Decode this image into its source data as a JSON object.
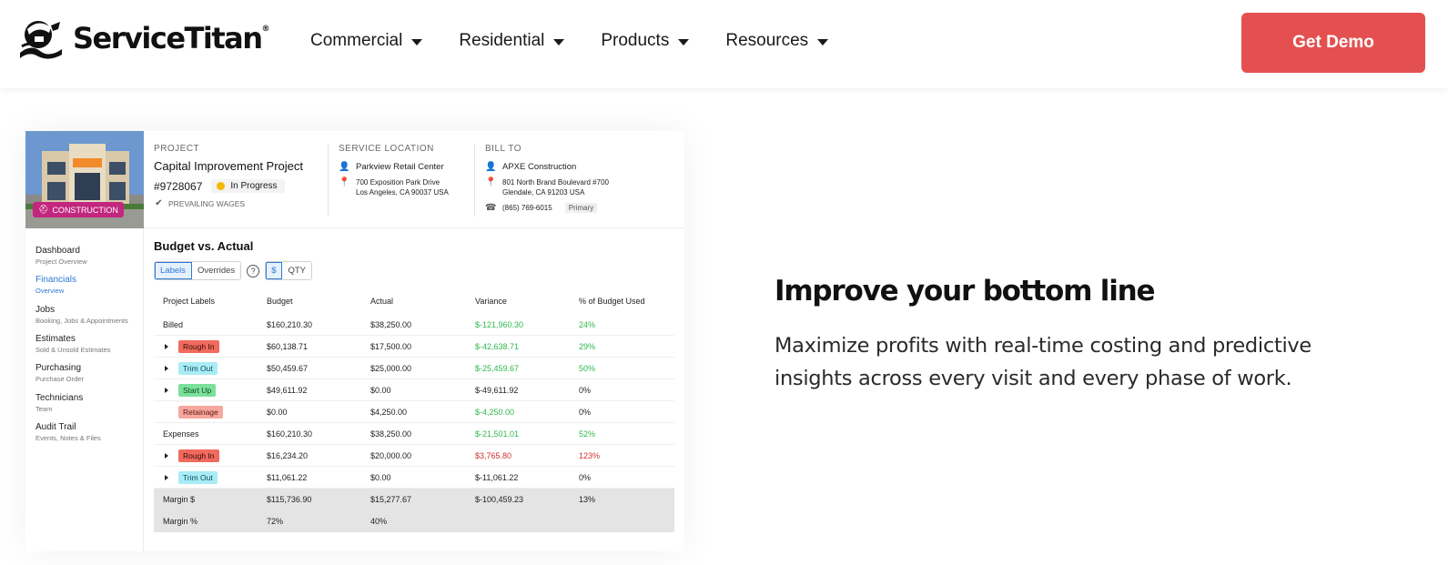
{
  "header": {
    "brand": "ServiceTitan",
    "brand_mark": "®",
    "nav": [
      "Commercial",
      "Residential",
      "Products",
      "Resources"
    ],
    "cta": "Get Demo",
    "cta_color": "#e45050"
  },
  "project": {
    "badge": "CONSTRUCTION",
    "project_label": "PROJECT",
    "project_name": "Capital Improvement Project",
    "project_number": "#9728067",
    "status": "In Progress",
    "wages": "PREVAILING WAGES",
    "service_label": "SERVICE LOCATION",
    "service_name": "Parkview Retail Center",
    "service_addr1": "700 Exposition Park Drive",
    "service_addr2": "Los Angeles, CA 90037 USA",
    "bill_label": "BILL TO",
    "bill_name": "APXE Construction",
    "bill_addr1": "801 North Brand Boulevard #700",
    "bill_addr2": "Glendale, CA 91203 USA",
    "bill_phone": "(865) 769-6015",
    "bill_phone_tag": "Primary"
  },
  "sidebar": [
    {
      "title": "Dashboard",
      "sub": "Project Overview"
    },
    {
      "title": "Financials",
      "sub": "Overview"
    },
    {
      "title": "Jobs",
      "sub": "Booking, Jobs & Appointments"
    },
    {
      "title": "Estimates",
      "sub": "Sold & Unsold Estimates"
    },
    {
      "title": "Purchasing",
      "sub": "Purchase Order"
    },
    {
      "title": "Technicians",
      "sub": "Team"
    },
    {
      "title": "Audit Trail",
      "sub": "Events, Notes & Files"
    }
  ],
  "budget": {
    "title": "Budget vs. Actual",
    "toggle_a": [
      "Labels",
      "Overrides"
    ],
    "help": "?",
    "toggle_b": [
      "$",
      "QTY"
    ],
    "columns": [
      "Project Labels",
      "Budget",
      "Actual",
      "Variance",
      "% of Budget Used"
    ],
    "rows": [
      {
        "label": "Billed",
        "budget": "$160,210.30",
        "actual": "$38,250.00",
        "variance": "$-121,960.30",
        "pct": "24%"
      },
      {
        "label": "Rough In",
        "budget": "$60,138.71",
        "actual": "$17,500.00",
        "variance": "$-42,638.71",
        "pct": "29%"
      },
      {
        "label": "Trim Out",
        "budget": "$50,459.67",
        "actual": "$25,000.00",
        "variance": "$-25,459.67",
        "pct": "50%"
      },
      {
        "label": "Start Up",
        "budget": "$49,611.92",
        "actual": "$0.00",
        "variance": "$-49,611.92",
        "pct": "0%"
      },
      {
        "label": "Retainage",
        "budget": "$0.00",
        "actual": "$4,250.00",
        "variance": "$-4,250.00",
        "pct": "0%"
      },
      {
        "label": "Expenses",
        "budget": "$160,210.30",
        "actual": "$38,250.00",
        "variance": "$-21,501.01",
        "pct": "52%"
      },
      {
        "label": "Rough In",
        "budget": "$16,234.20",
        "actual": "$20,000.00",
        "variance": "$3,765.80",
        "pct": "123%"
      },
      {
        "label": "Trim Out",
        "budget": "$11,061.22",
        "actual": "$0.00",
        "variance": "$-11,061.22",
        "pct": "0%"
      },
      {
        "label": "Margin $",
        "budget": "$115,736.90",
        "actual": "$15,277.67",
        "variance": "$-100,459.23",
        "pct": "13%"
      },
      {
        "label": "Margin %",
        "budget": "72%",
        "actual": "40%"
      }
    ]
  },
  "promo": {
    "headline": "Improve your bottom line",
    "body": "Maximize profits with real-time costing and predictive insights across every visit and every phase of work."
  }
}
